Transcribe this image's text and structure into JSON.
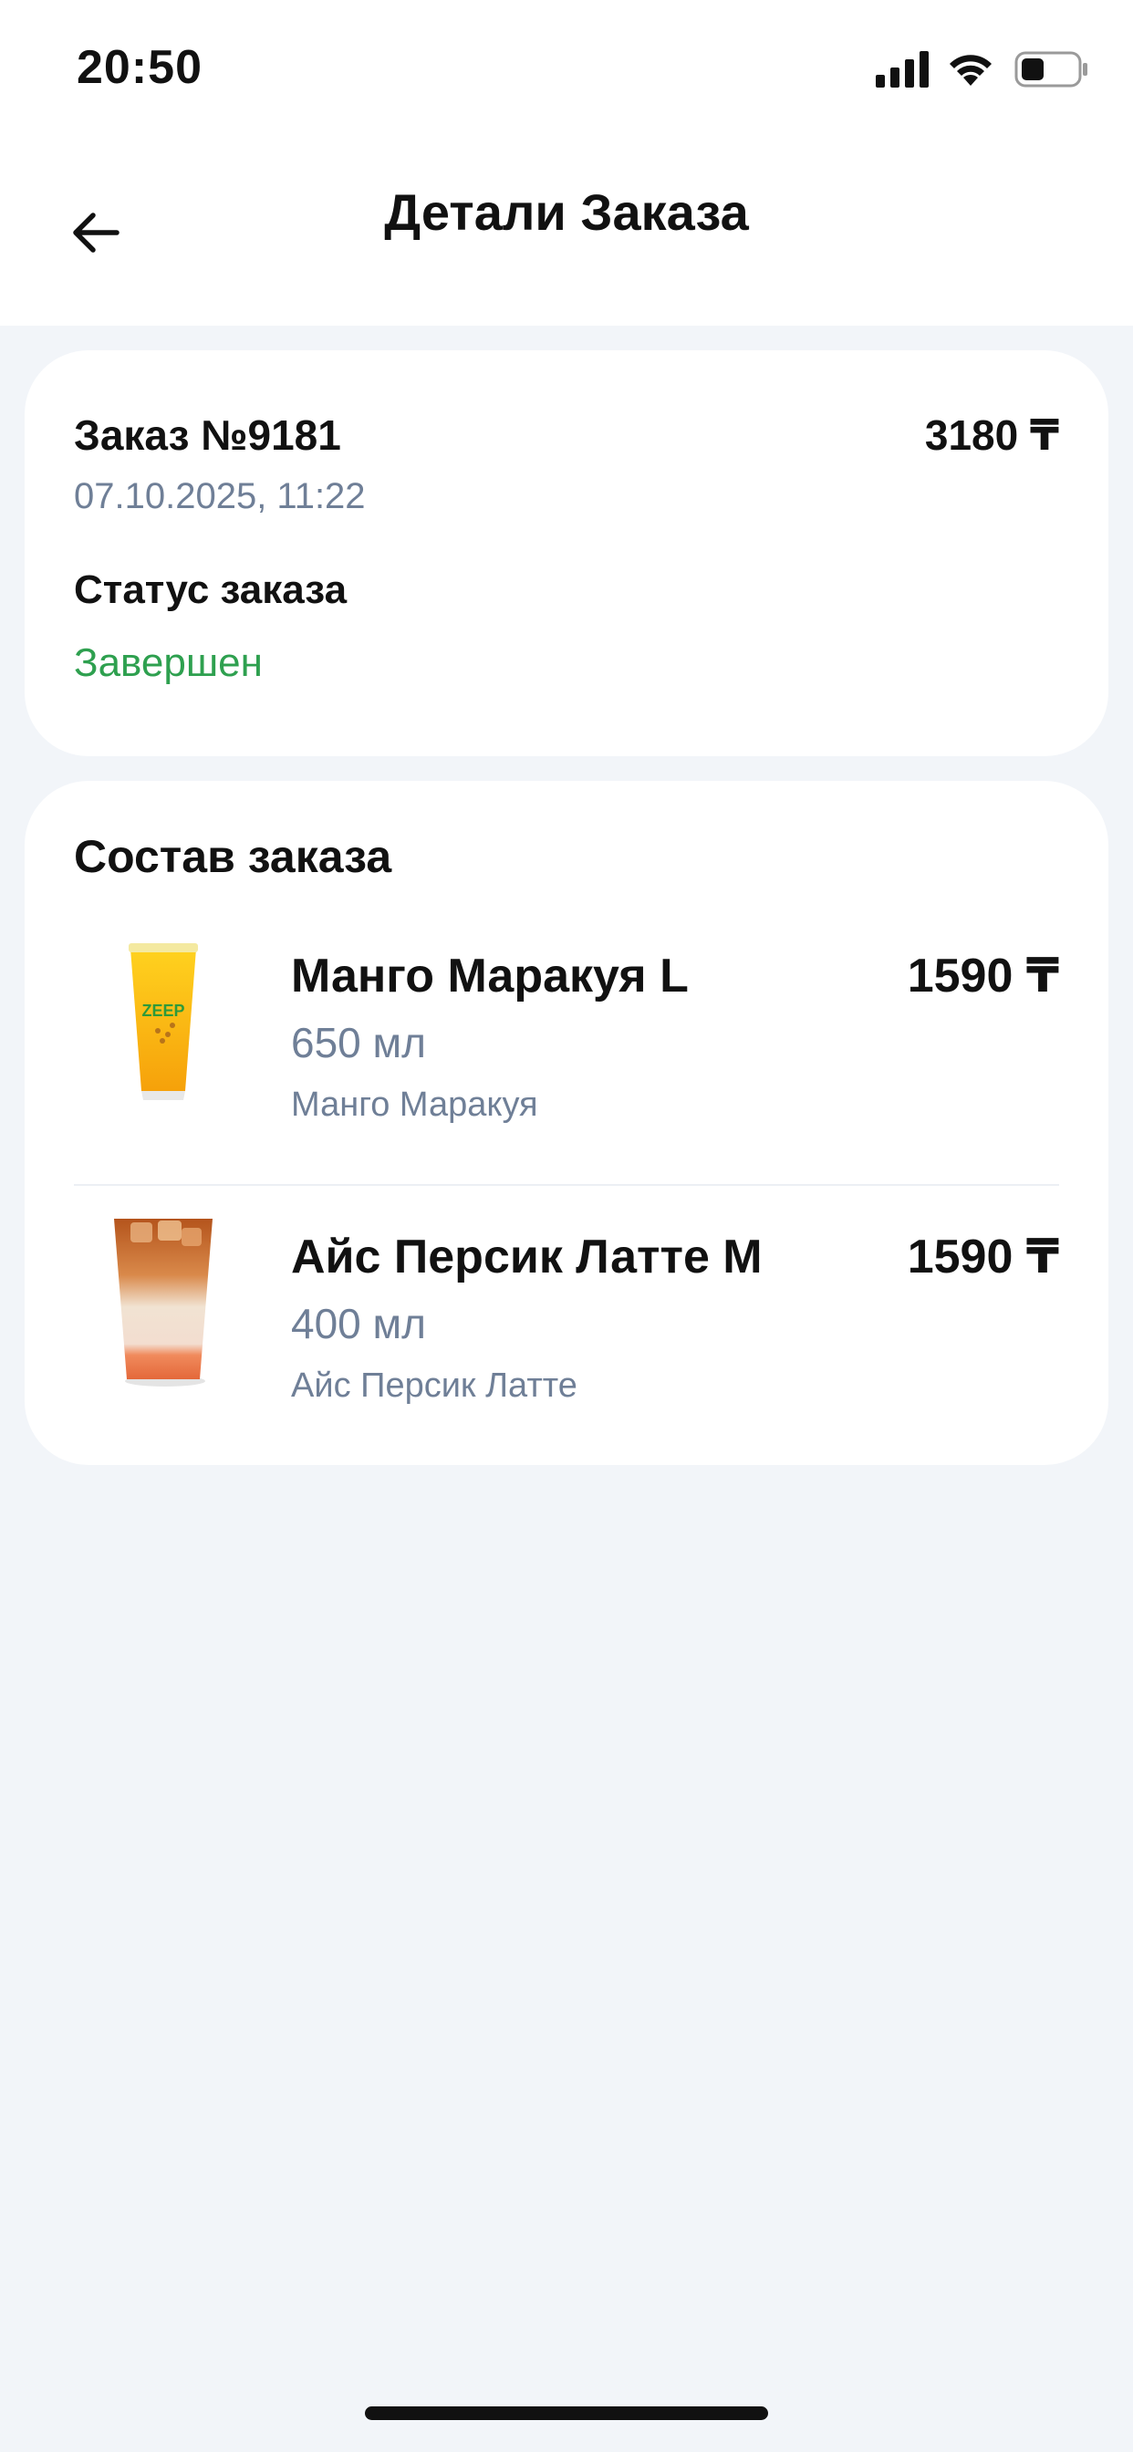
{
  "status_bar": {
    "time": "20:50",
    "icons": [
      "signal-icon",
      "wifi-icon",
      "battery-icon"
    ]
  },
  "header": {
    "title": "Детали Заказа",
    "back_icon": "arrow-left-icon"
  },
  "order": {
    "number": "Заказ №9181",
    "total": "3180 ₸",
    "date": "07.10.2025, 11:22",
    "status_label": "Статус заказа",
    "status_value": "Завершен",
    "status_color": "#2ea04f"
  },
  "composition": {
    "title": "Состав заказа",
    "items": [
      {
        "name": "Манго Маракуя L",
        "price": "1590 ₸",
        "volume": "650 мл",
        "base": "Манго Маракуя",
        "image": "mango-passionfruit-drink-image",
        "cup_label": "ZEEP"
      },
      {
        "name": "Айс Персик Латте M",
        "price": "1590 ₸",
        "volume": "400 мл",
        "base": "Айс Персик Латте",
        "image": "iced-peach-latte-image"
      }
    ]
  },
  "colors": {
    "background": "#f2f5f9",
    "card": "#ffffff",
    "secondary_text": "#6f7f97",
    "success": "#2ea04f"
  }
}
